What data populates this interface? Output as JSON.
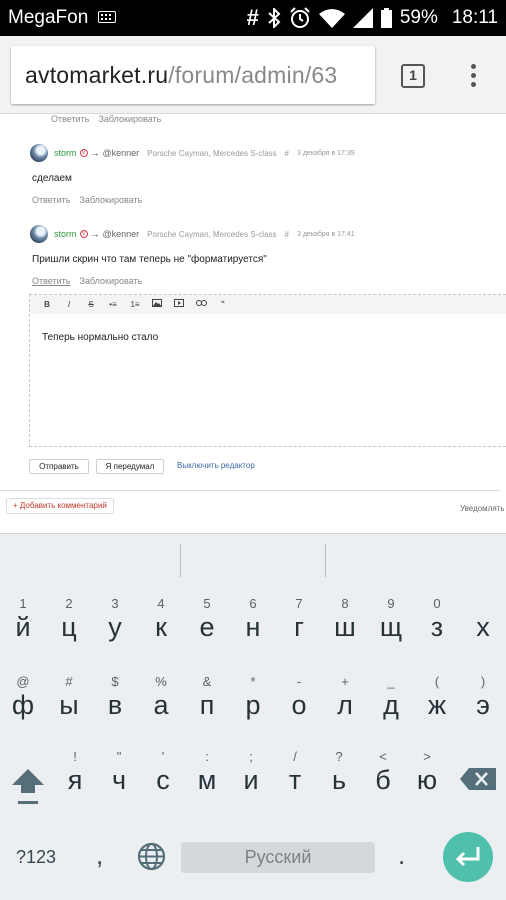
{
  "status_bar": {
    "carrier": "MegaFon",
    "battery": "59%",
    "time": "18:11"
  },
  "browser": {
    "url_host": "avtomarket.ru",
    "url_path": "/forum/admin/63",
    "tab_count": "1"
  },
  "actions": {
    "reply": "Ответить",
    "block": "Заблокировать"
  },
  "comments": [
    {
      "user": "storm",
      "arrow": "→",
      "to": "@kenner",
      "cars": "Porsche Cayman, Mercedes S-class",
      "hash": "#",
      "date": "3 декабря в 17:39",
      "text": "сделаем"
    },
    {
      "user": "storm",
      "arrow": "→",
      "to": "@kenner",
      "cars": "Porsche Cayman, Mercedes S-class",
      "hash": "#",
      "date": "3 декабря в 17:41",
      "text": "Пришли скрин что там теперь не \"форматируется\""
    }
  ],
  "editor": {
    "toolbar": [
      "B",
      "I",
      "S",
      "•≡",
      "1≡",
      "img",
      "▶",
      "link",
      "“"
    ],
    "text": "Теперь нормально стало"
  },
  "buttons": {
    "send": "Отправить",
    "changed_mind": "Я передумал",
    "disable_editor": "Выключить редактор"
  },
  "add_comment": {
    "plus": "+",
    "label": "Добавить комментарий"
  },
  "notify": "Уведомлять",
  "keyboard": {
    "row1": [
      [
        "1",
        "й"
      ],
      [
        "2",
        "ц"
      ],
      [
        "3",
        "у"
      ],
      [
        "4",
        "к"
      ],
      [
        "5",
        "е"
      ],
      [
        "6",
        "н"
      ],
      [
        "7",
        "г"
      ],
      [
        "8",
        "ш"
      ],
      [
        "9",
        "щ"
      ],
      [
        "0",
        "з"
      ],
      [
        "",
        "х"
      ]
    ],
    "row2": [
      [
        "@",
        "ф"
      ],
      [
        "#",
        "ы"
      ],
      [
        "$",
        "в"
      ],
      [
        "%",
        "а"
      ],
      [
        "&",
        "п"
      ],
      [
        "*",
        "р"
      ],
      [
        "-",
        "о"
      ],
      [
        "+",
        "л"
      ],
      [
        "_",
        "д"
      ],
      [
        "(",
        "ж"
      ],
      [
        ")",
        "э"
      ]
    ],
    "row3": [
      [
        "!",
        "я"
      ],
      [
        "\"",
        "ч"
      ],
      [
        "'",
        "с"
      ],
      [
        ":",
        "м"
      ],
      [
        ";",
        "и"
      ],
      [
        "/",
        "т"
      ],
      [
        "?",
        "ь"
      ],
      [
        "<",
        "б"
      ],
      [
        ">",
        "ю"
      ]
    ],
    "symbols": "?123",
    "comma": ",",
    "space": "Русский",
    "period": "."
  },
  "colors": {
    "accent_green": "#2e9a3f",
    "enter_key": "#4fc0ac",
    "add_comment_red": "#c0392b",
    "link_blue": "#3d6aa8"
  }
}
